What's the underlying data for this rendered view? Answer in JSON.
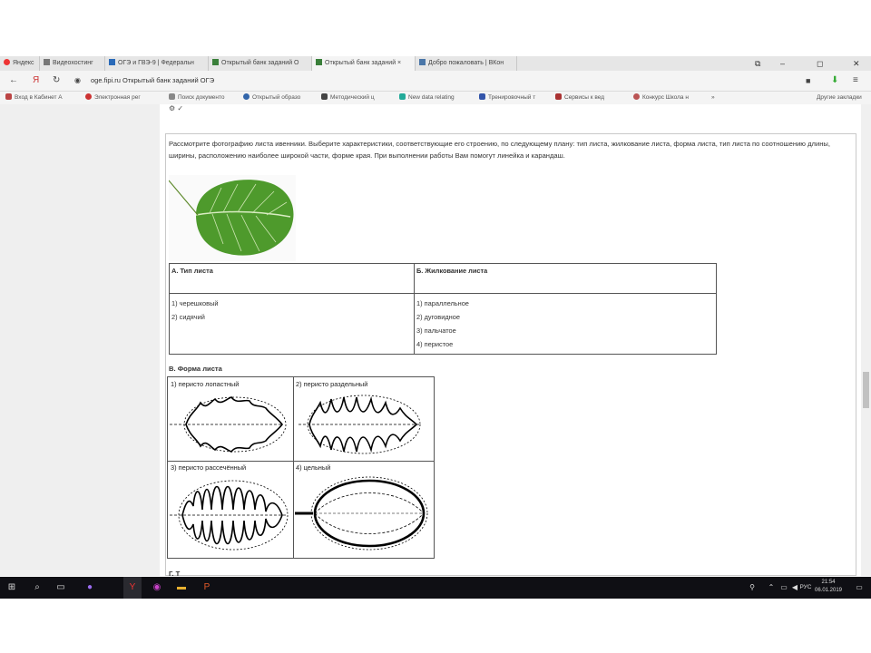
{
  "browser": {
    "tabs": [
      {
        "label": "Яндекс",
        "active": false
      },
      {
        "label": "Видеохостинг",
        "active": false
      },
      {
        "label": "ОГЭ и ГВЭ-9 | Федеральн",
        "active": false
      },
      {
        "label": "Открытый банк заданий О",
        "active": false
      },
      {
        "label": "Открытый банк заданий ×",
        "active": true
      },
      {
        "label": "Добро пожаловать | ВКон",
        "active": false
      }
    ],
    "window_buttons": [
      "⧉",
      "‒",
      "◻",
      "✕"
    ],
    "nav": {
      "back": "←",
      "yandex": "Я",
      "reload": "↻"
    },
    "url": "oge.fipi.ru   Открытый банк заданий ОГЭ",
    "bookmarks": [
      "Вход в Кабинет А",
      "Электронная рег",
      "Поиск документо",
      "Открытый образо",
      "Методический ц",
      "New data relating",
      "Тренировочный т",
      "Сервисы к вед",
      "Конкурс Школа н",
      "»",
      "Другие закладки"
    ]
  },
  "task": {
    "prompt": "Рассмотрите фотографию листа ивенники. Выберите характеристики, соответствующие его строению, по следующему плану: тип листа, жилкование листа, форма листа, тип листа по соотношению длины, ширины, расположению наиболее широкой части, форме края. При выполнении работы Вам помогут линейка и карандаш.",
    "table": {
      "col_a_header": "А. Тип листа",
      "col_b_header": "Б. Жилкование листа",
      "col_a_items": [
        "1) черешковый",
        "2) сидячий"
      ],
      "col_b_items": [
        "1) параллельное",
        "2) дуговидное",
        "3) пальчатое",
        "4) перистое"
      ]
    },
    "form_title": "В. Форма листа",
    "forms": [
      "1) перисто лопастный",
      "2) перисто раздельный",
      "3) перисто рассечённый",
      "4) цельный"
    ],
    "next_item_fragment": "Г. Т"
  },
  "taskbar": {
    "start_icon": "windows-icon",
    "lang": "РУС",
    "time": "21:54",
    "date": "06.01.2019"
  },
  "colors": {
    "taskbar": "#0f0f14",
    "leaf": "#4e9a2c",
    "tab_bg": "#e6e6e6"
  }
}
